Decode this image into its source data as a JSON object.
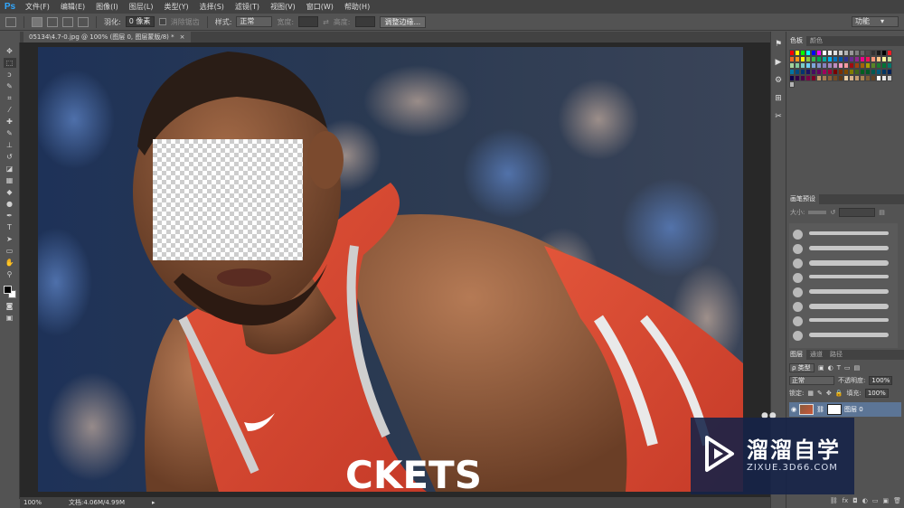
{
  "app": {
    "logo": "Ps"
  },
  "menu": {
    "items": [
      "文件(F)",
      "编辑(E)",
      "图像(I)",
      "图层(L)",
      "类型(Y)",
      "选择(S)",
      "滤镜(T)",
      "视图(V)",
      "窗口(W)",
      "帮助(H)"
    ]
  },
  "options": {
    "feather_label": "羽化:",
    "feather_value": "0 像素",
    "antialias_label": "消除锯齿",
    "style_label": "样式:",
    "style_value": "正常",
    "width_label": "宽度:",
    "height_label": "高度:",
    "refine_edge_label": "调整边缘...",
    "workspace_value": "功能"
  },
  "document": {
    "tab_title": "05134\\4.7-0.jpg @ 100% (图层 0, 图层蒙版/8) *",
    "tab_close": "×",
    "zoom": "100%",
    "doc_info": "文档:4.06M/4.99M"
  },
  "tools": [
    {
      "name": "move-tool",
      "glyph": "✥"
    },
    {
      "name": "marquee-tool",
      "glyph": "⬚"
    },
    {
      "name": "lasso-tool",
      "glyph": "ↄ"
    },
    {
      "name": "quick-select-tool",
      "glyph": "✎"
    },
    {
      "name": "crop-tool",
      "glyph": "⌗"
    },
    {
      "name": "eyedropper-tool",
      "glyph": "⁄"
    },
    {
      "name": "healing-brush-tool",
      "glyph": "✚"
    },
    {
      "name": "brush-tool",
      "glyph": "✎"
    },
    {
      "name": "clone-stamp-tool",
      "glyph": "⊥"
    },
    {
      "name": "history-brush-tool",
      "glyph": "↺"
    },
    {
      "name": "eraser-tool",
      "glyph": "◪"
    },
    {
      "name": "gradient-tool",
      "glyph": "▦"
    },
    {
      "name": "blur-tool",
      "glyph": "◆"
    },
    {
      "name": "dodge-tool",
      "glyph": "●"
    },
    {
      "name": "pen-tool",
      "glyph": "✒"
    },
    {
      "name": "type-tool",
      "glyph": "T"
    },
    {
      "name": "path-select-tool",
      "glyph": "➤"
    },
    {
      "name": "rectangle-tool",
      "glyph": "▭"
    },
    {
      "name": "hand-tool",
      "glyph": "✋"
    },
    {
      "name": "zoom-tool",
      "glyph": "⚲"
    }
  ],
  "swatches_panel": {
    "tabs": [
      "色板",
      "颜色"
    ],
    "colors": [
      "#ff0000",
      "#ffff00",
      "#00ff00",
      "#00ffff",
      "#0000ff",
      "#ff00ff",
      "#ffffff",
      "#f2f2f2",
      "#e0e0e0",
      "#cccccc",
      "#b3b3b3",
      "#999999",
      "#808080",
      "#666666",
      "#4d4d4d",
      "#333333",
      "#1a1a1a",
      "#000000",
      "#ed1c24",
      "#f26522",
      "#f7941d",
      "#fff200",
      "#8dc63f",
      "#39b54a",
      "#00a651",
      "#00a99d",
      "#00aeef",
      "#0072bc",
      "#0054a6",
      "#2e3192",
      "#662d91",
      "#92278f",
      "#ec008c",
      "#ed145b",
      "#f69679",
      "#fdc689",
      "#fff799",
      "#c4df9b",
      "#a3d39c",
      "#82ca9c",
      "#7accc8",
      "#6dcff6",
      "#7da7d9",
      "#8393ca",
      "#8781bd",
      "#a186be",
      "#bd8cbf",
      "#f49ac1",
      "#f5989d",
      "#9e0b0f",
      "#a0410d",
      "#a36209",
      "#aba000",
      "#598527",
      "#1a7b30",
      "#007236",
      "#00746b",
      "#0076a3",
      "#004b80",
      "#003471",
      "#1b1464",
      "#440e62",
      "#630460",
      "#9e005d",
      "#9e0039",
      "#790000",
      "#7b2e00",
      "#7d4900",
      "#827b00",
      "#406618",
      "#005e20",
      "#005826",
      "#005952",
      "#005b7f",
      "#003663",
      "#002157",
      "#0d004c",
      "#32004b",
      "#4b0049",
      "#7b0046",
      "#7a0026",
      "#c69c6d",
      "#a67c52",
      "#8c6239",
      "#754c24",
      "#603913",
      "#ebcfa8",
      "#d9b48c",
      "#c39b6e",
      "#a88350",
      "#7d5c35",
      "#604326",
      "#ffffff",
      "#e6e6e6",
      "#cccccc",
      "#b3b3b3"
    ]
  },
  "brush_panel": {
    "title": "画笔预设",
    "size_label": "大小:",
    "brush_count": 8
  },
  "layers_panel": {
    "tabs": [
      "图层",
      "通道",
      "路径"
    ],
    "filter_label": "ρ 类型",
    "blend_mode": "正常",
    "opacity_label": "不透明度:",
    "opacity_value": "100%",
    "lock_label": "锁定:",
    "fill_label": "填充:",
    "fill_value": "100%",
    "layer_name": "图层 0"
  },
  "watermark": {
    "title": "溜溜自学",
    "url": "ZIXUE.3D66.COM"
  }
}
